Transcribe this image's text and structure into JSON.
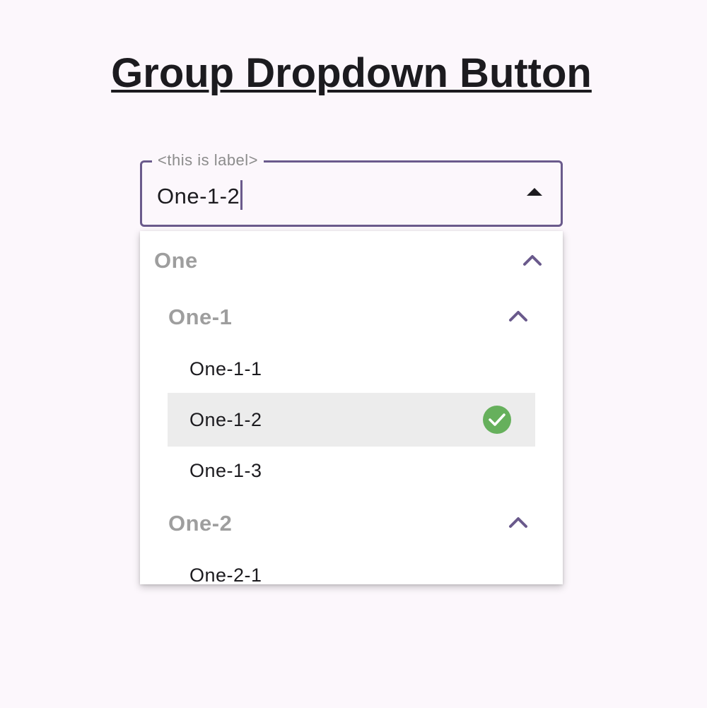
{
  "title": "Group Dropdown Button",
  "field": {
    "label": "<this is label>",
    "value": "One-1-2",
    "toggle_icon": "arrow-up-icon",
    "accent_color": "#6a5a8c"
  },
  "menu": {
    "groups": [
      {
        "label": "One",
        "icon": "chevron-up-icon",
        "expanded": true
      },
      {
        "label": "One-1",
        "icon": "chevron-up-icon",
        "expanded": true
      },
      {
        "label": "One-2",
        "icon": "chevron-up-icon",
        "expanded": true
      }
    ],
    "options": [
      {
        "label": "One-1-1",
        "selected": false
      },
      {
        "label": "One-1-2",
        "selected": true,
        "icon": "check-circle-icon",
        "icon_color": "#66b05c"
      },
      {
        "label": "One-1-3",
        "selected": false
      },
      {
        "label": "One-2-1",
        "selected": false
      }
    ],
    "selected_background": "#ececec"
  }
}
